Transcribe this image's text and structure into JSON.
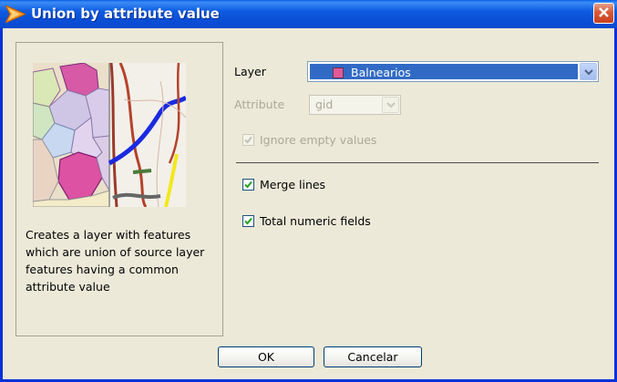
{
  "window": {
    "title": "Union by attribute value"
  },
  "icons": {
    "app": "plugin-arrow-icon",
    "close": "close-icon",
    "combo_arrow": "chevron-down-icon",
    "check": "checkmark-icon"
  },
  "info_panel": {
    "description": "Creates a layer with features which are union of source layer features having a common attribute value"
  },
  "form": {
    "layer_label": "Layer",
    "layer_value": "Balnearios",
    "layer_swatch_color": "#e05a97",
    "attribute_label": "Attribute",
    "attribute_value": "gid",
    "ignore_empty_label": "Ignore empty values",
    "ignore_empty_checked": true,
    "merge_lines_label": "Merge lines",
    "merge_lines_checked": true,
    "total_numeric_label": "Total numeric fields",
    "total_numeric_checked": true
  },
  "buttons": {
    "ok_label": "OK",
    "cancel_label": "Cancelar"
  },
  "colors": {
    "titlebar": "#0a4fd6",
    "selection": "#316ac5",
    "dialog_bg": "#ece9d8"
  }
}
